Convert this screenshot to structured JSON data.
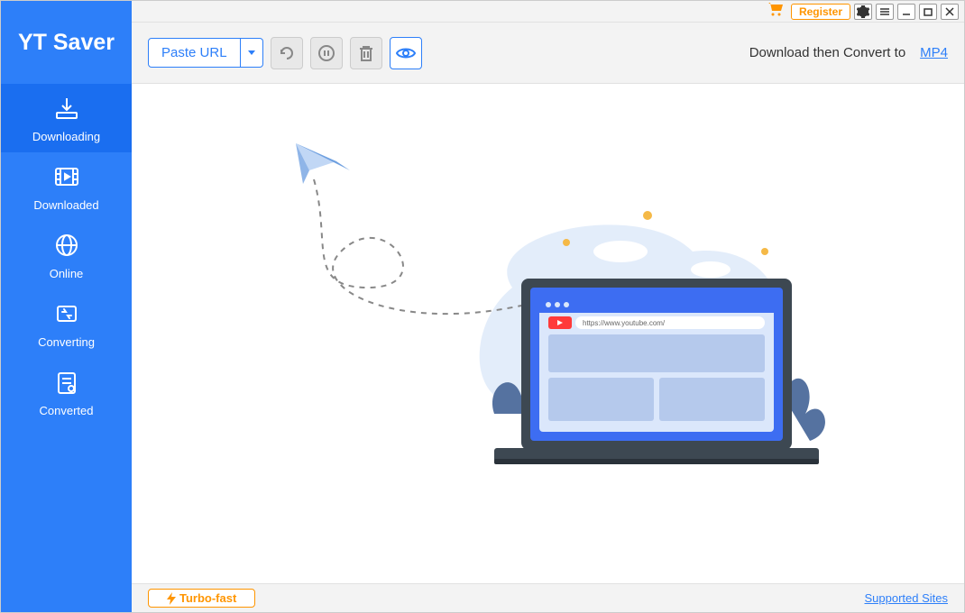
{
  "app_title": "YT Saver",
  "titlebar": {
    "register_label": "Register"
  },
  "sidebar": {
    "items": [
      {
        "label": "Downloading",
        "icon": "download-arrow",
        "active": true
      },
      {
        "label": "Downloaded",
        "icon": "film",
        "active": false
      },
      {
        "label": "Online",
        "icon": "globe",
        "active": false
      },
      {
        "label": "Converting",
        "icon": "refresh-cycle",
        "active": false
      },
      {
        "label": "Converted",
        "icon": "clipboard-check",
        "active": false
      }
    ]
  },
  "toolbar": {
    "paste_url_label": "Paste URL",
    "convert_prefix": "Download then Convert to",
    "convert_format": "MP4"
  },
  "illustration": {
    "url_text": "https://www.youtube.com/"
  },
  "footer": {
    "turbo_label": "Turbo-fast",
    "supported_sites_label": "Supported Sites"
  }
}
